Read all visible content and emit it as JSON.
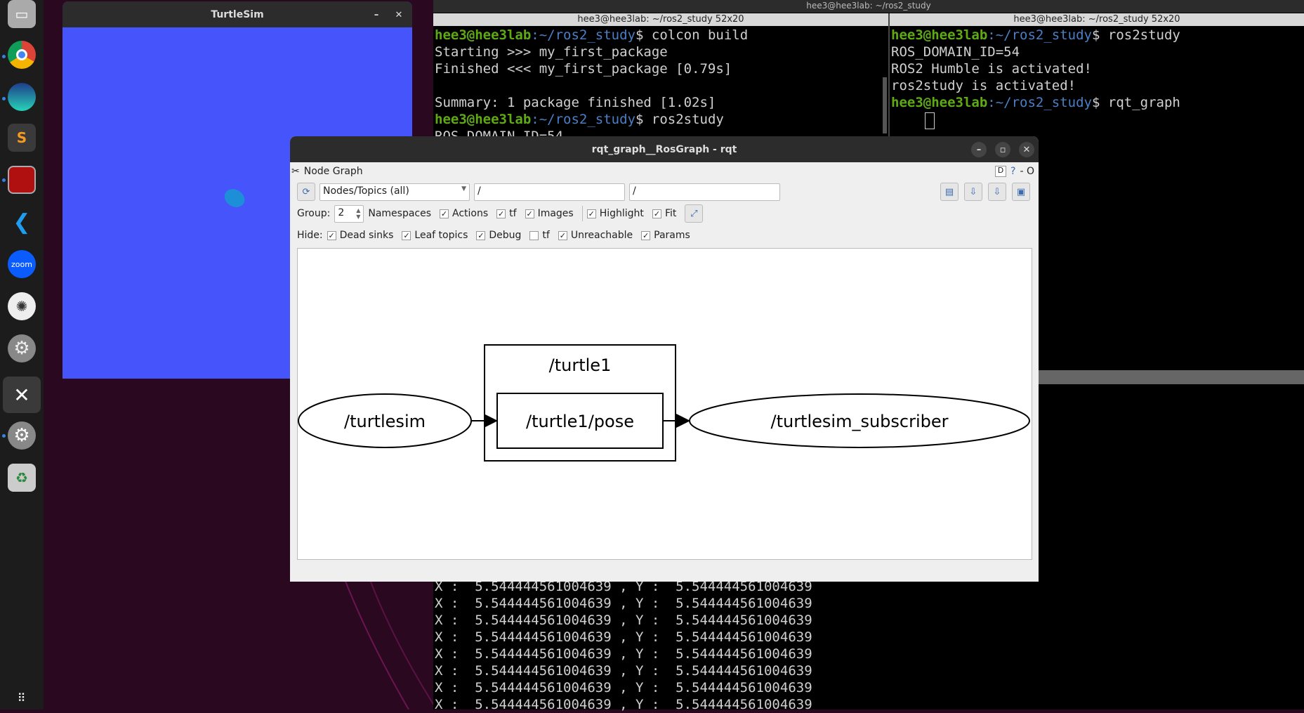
{
  "dock": {
    "items": [
      "files-icon",
      "chrome-icon",
      "whale-browser-icon",
      "sublime-icon",
      "terminator-icon",
      "vscode-icon",
      "zoom-icon",
      "chatgpt-icon",
      "settings-gear-icon",
      "rqt-tools-icon",
      "settings-icon",
      "trash-icon",
      "app-grid-icon"
    ],
    "zoom_label": "zoom"
  },
  "turtlesim": {
    "title": "TurtleSim",
    "bg": "#4554fb"
  },
  "terminal": {
    "title": "hee3@hee3lab: ~/ros2_study",
    "left": {
      "header": "hee3@hee3lab: ~/ros2_study 52x20",
      "lines": [
        {
          "user": "hee3@hee3lab",
          "path": ":~/ros2_study",
          "cmd": "$ colcon build"
        },
        {
          "text": "Starting >>> my_first_package"
        },
        {
          "text": "Finished <<< my_first_package [0.79s]"
        },
        {
          "text": ""
        },
        {
          "text": "Summary: 1 package finished [1.02s]"
        },
        {
          "user": "hee3@hee3lab",
          "path": ":~/ros2_study",
          "cmd": "$ ros2study"
        },
        {
          "text": "ROS_DOMAIN_ID=54"
        }
      ]
    },
    "right": {
      "header": "hee3@hee3lab: ~/ros2_study 52x20",
      "lines": [
        {
          "user": "hee3@hee3lab",
          "path": ":~/ros2_study",
          "cmd": "$ ros2study"
        },
        {
          "text": "ROS_DOMAIN_ID=54"
        },
        {
          "text": "ROS2 Humble is activated!"
        },
        {
          "text": "ros2study is activated!"
        },
        {
          "user": "hee3@hee3lab",
          "path": ":~/ros2_study",
          "cmd": "$ rqt_graph"
        }
      ]
    },
    "bottom_lines": [
      "X :  5.544444561004639 , Y :  5.544444561004639",
      "X :  5.544444561004639 , Y :  5.544444561004639",
      "X :  5.544444561004639 , Y :  5.544444561004639",
      "X :  5.544444561004639 , Y :  5.544444561004639",
      "X :  5.544444561004639 , Y :  5.544444561004639",
      "X :  5.544444561004639 , Y :  5.544444561004639",
      "X :  5.544444561004639 , Y :  5.544444561004639",
      "X :  5.544444561004639 , Y :  5.544444561004639"
    ]
  },
  "rqt": {
    "title": "rqt_graph__RosGraph - rqt",
    "plugin": "Node Graph",
    "plugin_right": "D",
    "plugin_dash": "- O",
    "mode": "Nodes/Topics (all)",
    "filter1": "/",
    "filter2": "/",
    "group_label": "Group:",
    "group_value": "2",
    "row1": [
      {
        "label": "Namespaces",
        "checked": null
      },
      {
        "label": "Actions",
        "checked": true
      },
      {
        "label": "tf",
        "checked": true
      },
      {
        "label": "Images",
        "checked": true
      },
      {
        "label": "Highlight",
        "checked": true
      },
      {
        "label": "Fit",
        "checked": true
      }
    ],
    "hide_label": "Hide:",
    "hide": [
      {
        "label": "Dead sinks",
        "checked": true
      },
      {
        "label": "Leaf topics",
        "checked": true
      },
      {
        "label": "Debug",
        "checked": true
      },
      {
        "label": "tf",
        "checked": false
      },
      {
        "label": "Unreachable",
        "checked": true
      },
      {
        "label": "Params",
        "checked": true
      }
    ],
    "graph": {
      "namespace": "/turtle1",
      "topic": "/turtle1/pose",
      "publisher": "/turtlesim",
      "subscriber": "/turtlesim_subscriber"
    }
  }
}
